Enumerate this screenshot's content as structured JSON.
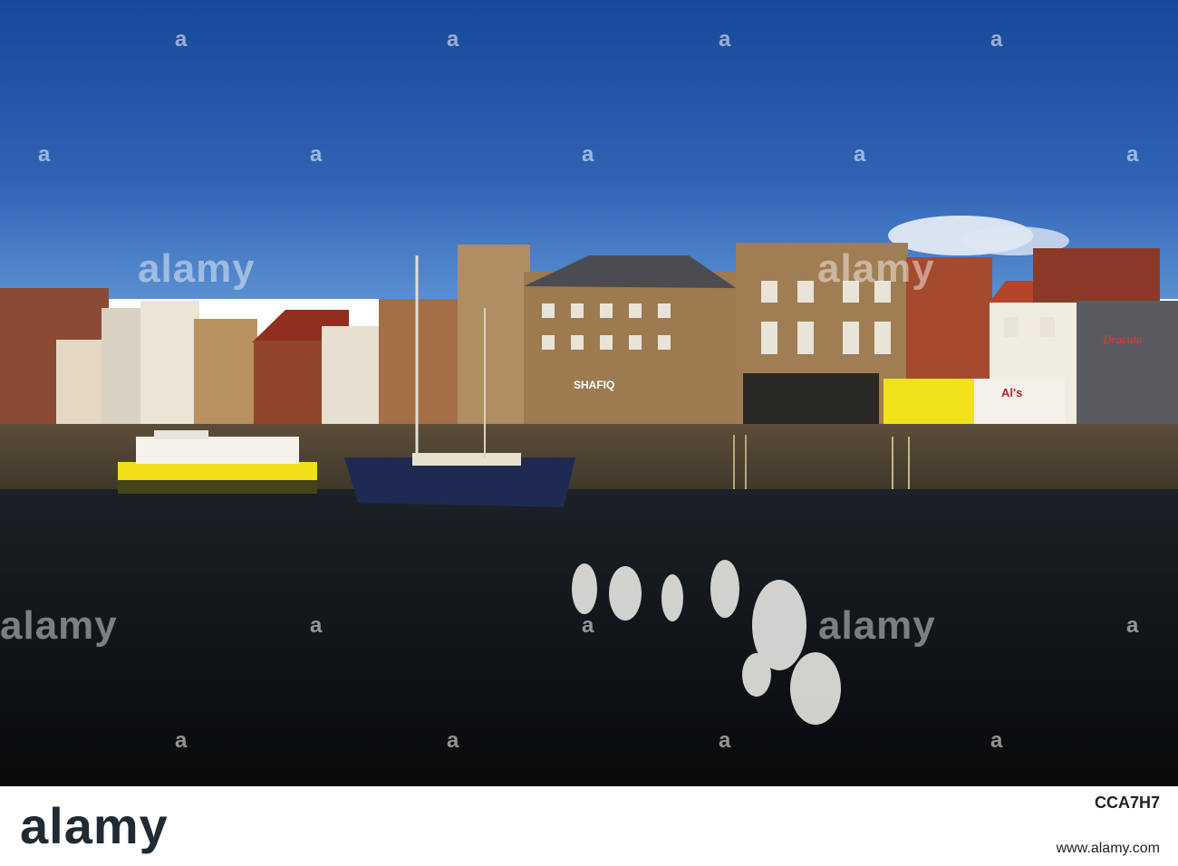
{
  "scene": {
    "description_labels": {
      "shop_sign_shafiq": "SHAFIQ",
      "shop_sign_als": "Al's",
      "shop_sign_dracula": "Dracula"
    },
    "colors": {
      "sky_top": "#1f4fa0",
      "sky_bottom": "#4e86cc",
      "water": "#11161b",
      "yellow_shop": "#f2e21a",
      "red_roof": "#a23a22",
      "stone": "#9b7d55"
    }
  },
  "watermark": {
    "text": "alamy",
    "mark": "a"
  },
  "footer": {
    "logo": "alamy",
    "image_id": "CCA7H7",
    "website": "www.alamy.com"
  }
}
